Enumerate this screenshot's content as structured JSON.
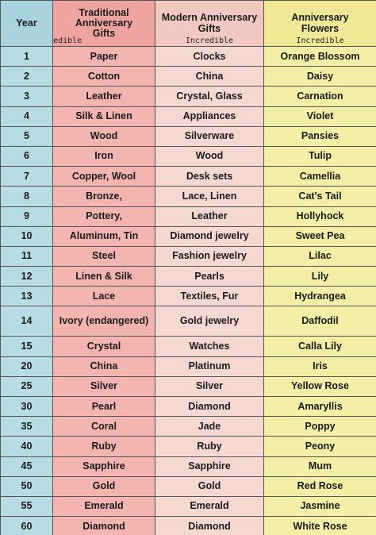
{
  "headers": {
    "year": "Year",
    "traditional": "Traditional Anniversary Gifts",
    "modern": "Modern Anniversary Gifts",
    "flowers": "Anniversary Flowers",
    "watermark": "Incredible"
  },
  "rows": [
    {
      "year": "1",
      "traditional": "Paper",
      "modern": "Clocks",
      "flower": "Orange Blossom"
    },
    {
      "year": "2",
      "traditional": "Cotton",
      "modern": "China",
      "flower": "Daisy"
    },
    {
      "year": "3",
      "traditional": "Leather",
      "modern": "Crystal, Glass",
      "flower": "Carnation"
    },
    {
      "year": "4",
      "traditional": "Silk & Linen",
      "modern": "Appliances",
      "flower": "Violet"
    },
    {
      "year": "5",
      "traditional": "Wood",
      "modern": "Silverware",
      "flower": "Pansies"
    },
    {
      "year": "6",
      "traditional": "Iron",
      "modern": "Wood",
      "flower": "Tulip"
    },
    {
      "year": "7",
      "traditional": "Copper, Wool",
      "modern": "Desk sets",
      "flower": "Camellia"
    },
    {
      "year": "8",
      "traditional": "Bronze,",
      "modern": "Lace, Linen",
      "flower": "Cat's Tail"
    },
    {
      "year": "9",
      "traditional": "Pottery,",
      "modern": "Leather",
      "flower": "Hollyhock"
    },
    {
      "year": "10",
      "traditional": "Aluminum, Tin",
      "modern": "Diamond jewelry",
      "flower": "Sweet Pea"
    },
    {
      "year": "11",
      "traditional": "Steel",
      "modern": "Fashion jewelry",
      "flower": "Lilac"
    },
    {
      "year": "12",
      "traditional": "Linen & Silk",
      "modern": "Pearls",
      "flower": "Lily"
    },
    {
      "year": "13",
      "traditional": "Lace",
      "modern": "Textiles, Fur",
      "flower": "Hydrangea"
    },
    {
      "year": "14",
      "traditional": "Ivory (endangered)",
      "modern": "Gold jewelry",
      "flower": "Daffodil"
    },
    {
      "year": "15",
      "traditional": "Crystal",
      "modern": "Watches",
      "flower": "Calla Lily"
    },
    {
      "year": "20",
      "traditional": "China",
      "modern": "Platinum",
      "flower": "Iris"
    },
    {
      "year": "25",
      "traditional": "Silver",
      "modern": "Silver",
      "flower": "Yellow Rose"
    },
    {
      "year": "30",
      "traditional": "Pearl",
      "modern": "Diamond",
      "flower": "Amaryllis"
    },
    {
      "year": "35",
      "traditional": "Coral",
      "modern": "Jade",
      "flower": "Poppy"
    },
    {
      "year": "40",
      "traditional": "Ruby",
      "modern": "Ruby",
      "flower": "Peony"
    },
    {
      "year": "45",
      "traditional": "Sapphire",
      "modern": "Sapphire",
      "flower": "Mum"
    },
    {
      "year": "50",
      "traditional": "Gold",
      "modern": "Gold",
      "flower": "Red Rose"
    },
    {
      "year": "55",
      "traditional": "Emerald",
      "modern": "Emerald",
      "flower": "Jasmine"
    },
    {
      "year": "60",
      "traditional": "Diamond",
      "modern": "Diamond",
      "flower": "White Rose"
    }
  ],
  "colors": {
    "year_column": "#b7dce4",
    "traditional_column": "#f4b4b0",
    "modern_column": "#f6d8d2",
    "flowers_column": "#f3efa6"
  }
}
